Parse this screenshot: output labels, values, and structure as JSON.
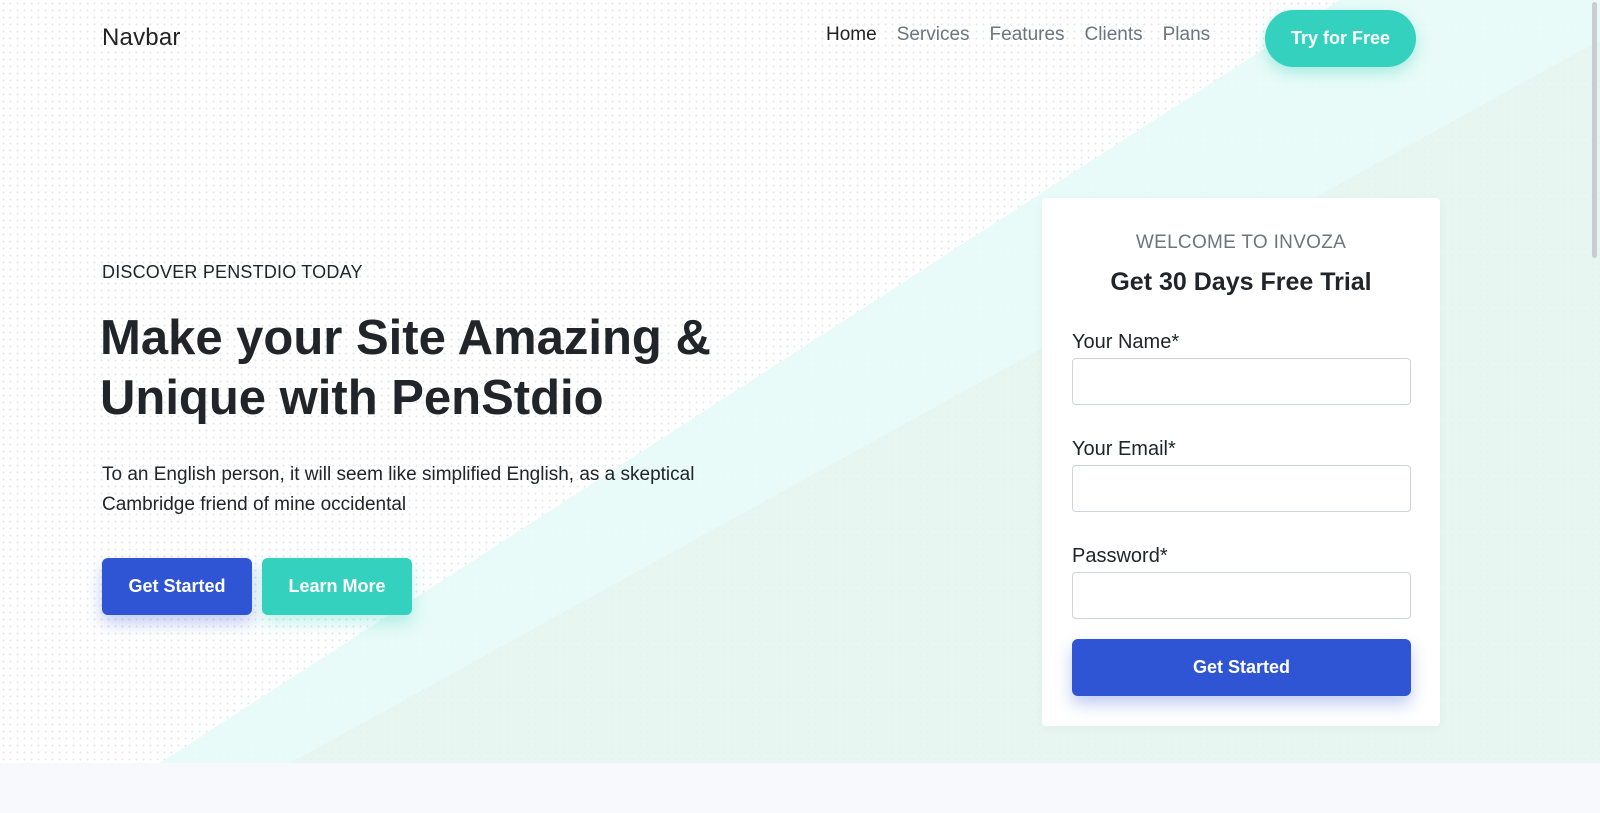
{
  "navbar": {
    "brand": "Navbar",
    "links": [
      {
        "label": "Home",
        "active": true
      },
      {
        "label": "Services",
        "active": false
      },
      {
        "label": "Features",
        "active": false
      },
      {
        "label": "Clients",
        "active": false
      },
      {
        "label": "Plans",
        "active": false
      }
    ],
    "cta_label": "Try for Free"
  },
  "hero": {
    "eyebrow": "DISCOVER PENSTDIO TODAY",
    "headline": "Make your Site Amazing & Unique with PenStdio",
    "lead": "To an English person, it will seem like simplified English, as a skeptical Cambridge friend of mine occidental",
    "primary_button": "Get Started",
    "secondary_button": "Learn More"
  },
  "signup_card": {
    "eyebrow": "WELCOME TO INVOZA",
    "title": "Get 30 Days Free Trial",
    "fields": [
      {
        "label": "Your Name*",
        "value": "",
        "placeholder": ""
      },
      {
        "label": "Your Email*",
        "value": "",
        "placeholder": ""
      },
      {
        "label": "Password*",
        "value": "",
        "placeholder": ""
      }
    ],
    "submit_label": "Get Started"
  },
  "colors": {
    "primary": "#2f55d4",
    "accent": "#33d1be",
    "hero_band": "#e6fbf7",
    "hero_shape": "#e3f4ef"
  }
}
